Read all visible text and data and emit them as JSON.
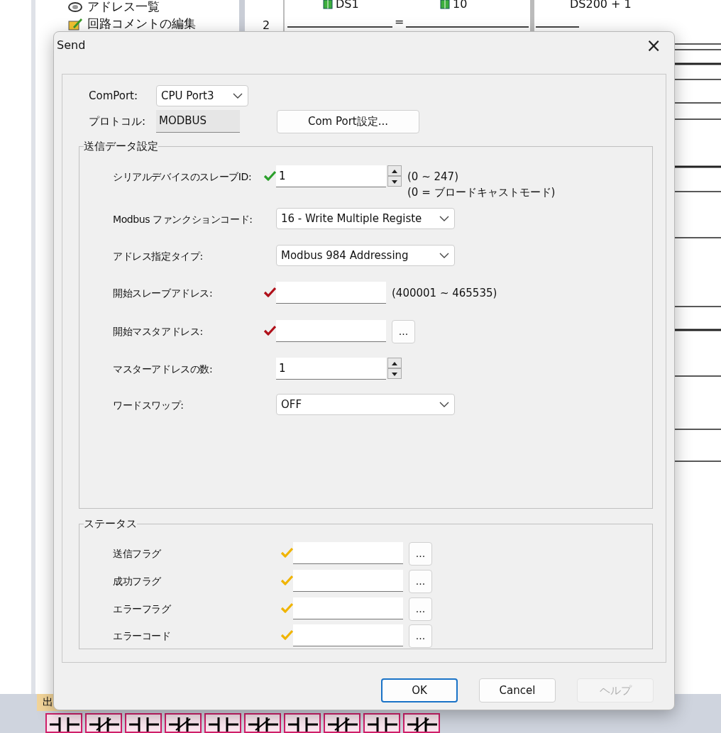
{
  "background": {
    "tree_items": [
      {
        "label": "アドレス一覧"
      },
      {
        "label": "回路コメントの編集"
      }
    ],
    "ladder": {
      "rung_number": "2",
      "operands": [
        "DS1",
        "10"
      ],
      "compare": "=",
      "result": "DS200 + 1"
    },
    "output_tab": "出"
  },
  "dialog": {
    "title": "Send",
    "close": "×",
    "comport": {
      "label": "ComPort:",
      "value": "CPU Port3"
    },
    "protocol": {
      "label": "プロトコル:",
      "value": "MODBUS"
    },
    "comport_button": "Com Port設定...",
    "send_group": {
      "title": "送信データ設定",
      "rows": [
        {
          "kind": "spin",
          "label": "シリアルデバイスのスレーブID:",
          "value": "1",
          "color": "#2ca02c",
          "hints": [
            "(0 ~ 247)",
            "(0 = ブロードキャストモード)"
          ]
        },
        {
          "kind": "select",
          "label": "Modbus ファンクションコード:",
          "value": "16 - Write Multiple Registe"
        },
        {
          "kind": "select",
          "label": "アドレス指定タイプ:",
          "value": "Modbus 984 Addressing"
        },
        {
          "kind": "text",
          "label": "開始スレーブアドレス:",
          "value": "",
          "color": "#b0101a",
          "hints": [
            "(400001 ~ 465535)"
          ]
        },
        {
          "kind": "browse",
          "label": "開始マスタアドレス:",
          "value": "",
          "color": "#b0101a",
          "browse": "..."
        },
        {
          "kind": "spin",
          "label": "マスターアドレスの数:",
          "value": "1"
        },
        {
          "kind": "select",
          "label": "ワードスワップ:",
          "value": "OFF"
        }
      ]
    },
    "status_group": {
      "title": "ステータス",
      "rows": [
        {
          "label": "送信フラグ",
          "color": "#f0b400",
          "browse": "..."
        },
        {
          "label": "成功フラグ",
          "color": "#f0b400",
          "browse": "..."
        },
        {
          "label": "エラーフラグ",
          "color": "#f0b400",
          "browse": "..."
        },
        {
          "label": "エラーコード",
          "color": "#f0b400",
          "browse": "..."
        }
      ]
    },
    "buttons": [
      {
        "label": "OK",
        "default": true,
        "disabled": false
      },
      {
        "label": "Cancel",
        "default": false,
        "disabled": false
      },
      {
        "label": "ヘルプ",
        "default": false,
        "disabled": true
      }
    ]
  }
}
